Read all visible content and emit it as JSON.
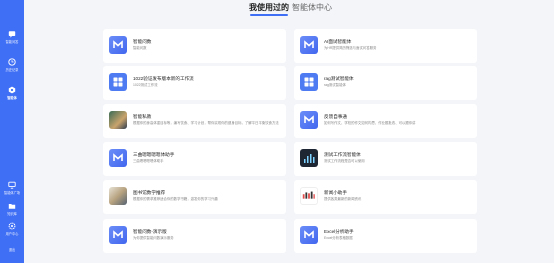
{
  "sidebar": {
    "items": [
      {
        "label": "智能问答",
        "icon": "chat-icon"
      },
      {
        "label": "历史记录",
        "icon": "history-icon"
      },
      {
        "label": "智能体",
        "icon": "agent-icon"
      },
      {
        "label": "智能体广场",
        "icon": "monitor-icon"
      },
      {
        "label": "知识库",
        "icon": "folder-icon"
      },
      {
        "label": "用户中心",
        "icon": "settings-icon"
      },
      {
        "label": "退出",
        "icon": "logout-icon"
      }
    ],
    "active_index": 2
  },
  "tabs": [
    {
      "label": "我使用过的",
      "active": true
    },
    {
      "label": "智能体中心",
      "active": false
    }
  ],
  "cards": [
    {
      "title": "智能问数",
      "desc": "智能问数",
      "icon": "logo-icon"
    },
    {
      "title": "AI面试智能体",
      "desc": "为HR提供简历筛选与面试问答服务",
      "icon": "logo-icon"
    },
    {
      "title": "1022验证发布版本新的工作流",
      "desc": "1022测试工作流",
      "icon": "grid-icon"
    },
    {
      "title": "rag测试智能体",
      "desc": "rag测试智能体",
      "icon": "grid-icon"
    },
    {
      "title": "智能私教",
      "desc": "根据你的身高体重目标等，编写饮食、学习计划，帮你实现你的健身目标，了解平日平衡饮食方法",
      "icon": "photo-icon"
    },
    {
      "title": "反馈自事通",
      "desc": "如何写作文、学校的作文如何构思、作业题批改、可以跟你讲",
      "icon": "logo-icon"
    },
    {
      "title": "三曲嗯嗯嗯嗯体助手",
      "desc": "三曲嗯嗯嗯嗯体助手",
      "icon": "logo-icon"
    },
    {
      "title": "测试工作流智能体",
      "desc": "测试工作流程是否可以使用",
      "icon": "dark-photo-icon"
    },
    {
      "title": "图书馆数学推荐",
      "desc": "根据你的需求推荐适合你的数学书籍，激发你的学习兴趣",
      "icon": "photo-icon"
    },
    {
      "title": "新闻小助手",
      "desc": "提供各类最新的新闻资讯",
      "icon": "bars-icon"
    },
    {
      "title": "智能问数-演示版",
      "desc": "为你提供智能问数演示服务",
      "icon": "logo-icon"
    },
    {
      "title": "Excel分析助手",
      "desc": "Excel分析表格数据",
      "icon": "logo-icon"
    }
  ],
  "colors": {
    "accent": "#3f6ff5",
    "background": "#f3f5f9",
    "card": "#ffffff"
  }
}
